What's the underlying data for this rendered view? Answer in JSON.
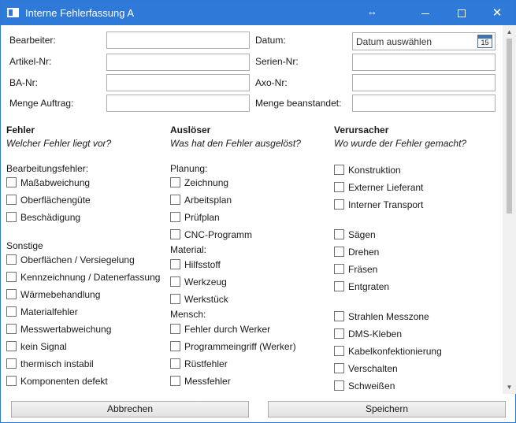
{
  "window": {
    "title": "Interne Fehlerfassung A",
    "resize_glyph": "↔"
  },
  "form": {
    "bearbeiter_label": "Bearbeiter:",
    "artikel_label": "Artikel-Nr:",
    "ba_label": "BA-Nr:",
    "menge_auftrag_label": "Menge Auftrag:",
    "datum_label": "Datum:",
    "serien_label": "Serien-Nr:",
    "axo_label": "Axo-Nr:",
    "menge_beanstandet_label": "Menge beanstandet:",
    "datum_placeholder": "Datum auswählen",
    "calendar_day": "15"
  },
  "fehler": {
    "heading": "Fehler",
    "question": "Welcher Fehler liegt vor?",
    "group1": "Bearbeitungsfehler:",
    "items1": [
      "Maßabweichung",
      "Oberflächengüte",
      "Beschädigung"
    ],
    "group2": "Sonstige",
    "items2": [
      "Oberflächen / Versiegelung",
      "Kennzeichnung / Datenerfassung",
      "Wärmebehandlung",
      "Materialfehler",
      "Messwertabweichung",
      "kein Signal",
      "thermisch instabil",
      "Komponenten defekt"
    ]
  },
  "ausloeser": {
    "heading": "Auslöser",
    "question": "Was hat den Fehler ausgelöst?",
    "group1": "Planung:",
    "items1": [
      "Zeichnung",
      "Arbeitsplan",
      "Prüfplan",
      "CNC-Programm"
    ],
    "group2": "Material:",
    "items2": [
      "Hilfsstoff",
      "Werkzeug",
      "Werkstück"
    ],
    "group3": "Mensch:",
    "items3": [
      "Fehler durch Werker",
      "Programmeingriff (Werker)",
      "Rüstfehler",
      "Messfehler"
    ]
  },
  "verursacher": {
    "heading": "Verursacher",
    "question": "Wo wurde der Fehler gemacht?",
    "items1": [
      "Konstruktion",
      "Externer Lieferant",
      "Interner Transport"
    ],
    "items2": [
      "Sägen",
      "Drehen",
      "Fräsen",
      "Entgraten"
    ],
    "items3": [
      "Strahlen Messzone",
      "DMS-Kleben",
      "Kabelkonfektionierung",
      "Verschalten",
      "Schweißen"
    ]
  },
  "buttons": {
    "cancel": "Abbrechen",
    "save": "Speichern"
  },
  "icons": {
    "window": "window-icon",
    "calendar": "calendar-icon",
    "minimize": "minimize-icon",
    "maximize": "maximize-icon",
    "close": "close-icon"
  },
  "colors": {
    "titlebar": "#2f79d9",
    "border": "#abadb3"
  }
}
